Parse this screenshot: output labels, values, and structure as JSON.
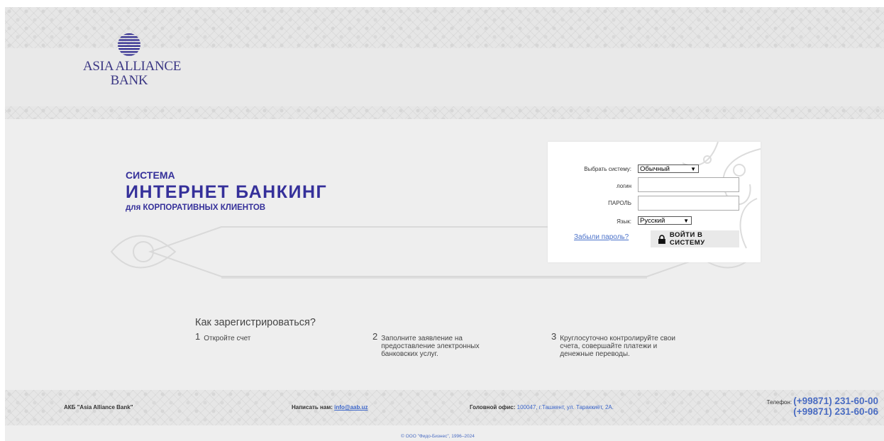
{
  "brand": {
    "line1": "ASIA ALLIANCE",
    "line2": "BANK"
  },
  "hero": {
    "subtitle_top": "СИСТЕМА",
    "title": "ИНТЕРНЕТ БАНКИНГ",
    "subtitle_bottom": "для КОРПОРАТИВНЫХ КЛИЕНТОВ"
  },
  "login": {
    "system_label": "Выбрать систему:",
    "system_value": "Обычный",
    "login_label": "логин",
    "password_label": "ПАРОЛЬ",
    "language_label": "Язык:",
    "language_value": "Русский",
    "forgot_link": "Забыли пароль?",
    "submit_label": "ВОЙТИ В СИСТЕМУ"
  },
  "how_to": {
    "title": "Как зарегистрироваться?",
    "steps": [
      {
        "num": "1",
        "text": "Откройте счет"
      },
      {
        "num": "2",
        "line1": "Заполните заявление на",
        "line2": "предоставление электронных",
        "line3": "банковских услуг."
      },
      {
        "num": "3",
        "line1": "Круглосуточно контролируйте свои",
        "line2": "счета, совершайте платежи и",
        "line3": "денежные переводы."
      }
    ]
  },
  "footer": {
    "company": "АКБ \"Asia Alliance Bank\"",
    "write_label": "Написать нам:",
    "email": "info@aab.uz",
    "office_label": "Головной офис:",
    "office_address": "100047, г.Ташкент, ул. Тараккиёт, 2А.",
    "phone_label": "Телефон:",
    "phone1": "(+99871) 231-60-00",
    "phone2": "(+99871) 231-60-06",
    "copyright": "© ООО \"Фидо-Бизнес\", 1996–2024"
  },
  "colors": {
    "brand": "#35309a",
    "link": "#4a71c9",
    "background": "#eeeeee"
  }
}
